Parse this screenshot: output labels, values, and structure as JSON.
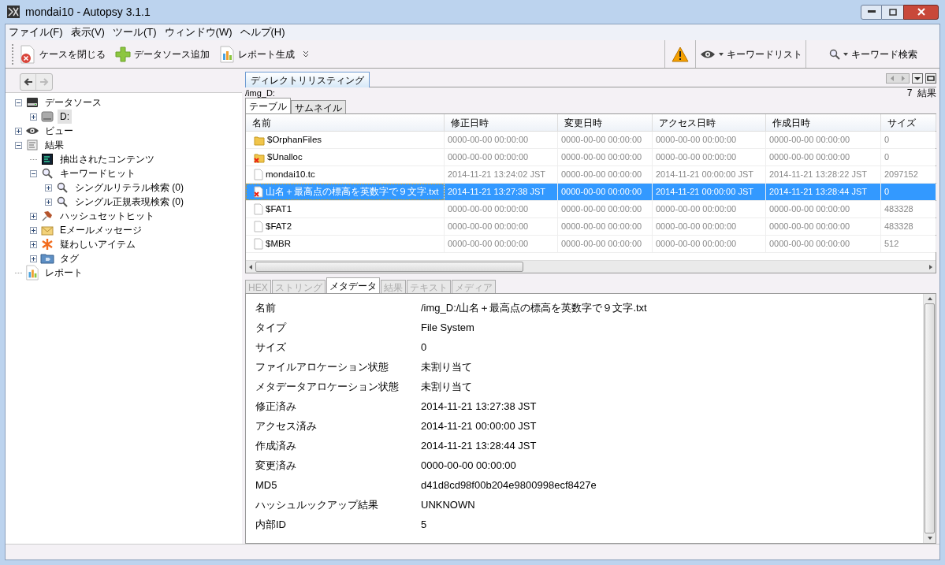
{
  "window": {
    "title": "mondai10 - Autopsy 3.1.1"
  },
  "menu": [
    "ファイル(F)",
    "表示(V)",
    "ツール(T)",
    "ウィンドウ(W)",
    "ヘルプ(H)"
  ],
  "toolbar": {
    "left": [
      {
        "kind": "close-case",
        "label": "ケースを閉じる"
      },
      {
        "kind": "add",
        "label": "データソース追加"
      },
      {
        "kind": "report",
        "label": "レポート生成"
      }
    ],
    "right": [
      {
        "kind": "warning"
      },
      {
        "kind": "eye",
        "label": "キーワードリスト"
      },
      {
        "kind": "search",
        "label": "キーワード検索"
      }
    ]
  },
  "tree": [
    {
      "label": "データソース",
      "kind": "drive",
      "expanded": true,
      "selected": false,
      "children": [
        {
          "label": "D:",
          "kind": "disk",
          "expanded": false,
          "selected": true
        }
      ]
    },
    {
      "label": "ビュー",
      "kind": "eye",
      "expanded": false,
      "selected": false
    },
    {
      "label": "結果",
      "kind": "results",
      "expanded": true,
      "selected": false,
      "children": [
        {
          "label": "抽出されたコンテンツ",
          "kind": "extracted",
          "selected": false
        },
        {
          "label": "キーワードヒット",
          "kind": "search",
          "expanded": true,
          "selected": false,
          "children": [
            {
              "label": "シングルリテラル検索 (0)",
              "kind": "search",
              "expanded": false,
              "selected": false
            },
            {
              "label": "シングル正規表現検索 (0)",
              "kind": "search",
              "expanded": false,
              "selected": false
            }
          ]
        },
        {
          "label": "ハッシュセットヒット",
          "kind": "pin",
          "expanded": false,
          "selected": false
        },
        {
          "label": "Eメールメッセージ",
          "kind": "mail",
          "expanded": false,
          "selected": false
        },
        {
          "label": "疑わしいアイテム",
          "kind": "asterisk",
          "expanded": false,
          "selected": false
        },
        {
          "label": "タグ",
          "kind": "tag",
          "expanded": false,
          "selected": false
        }
      ]
    },
    {
      "label": "レポート",
      "kind": "report",
      "selected": false
    }
  ],
  "directory_tab": "ディレクトリリスティング",
  "path": "/img_D:",
  "result_count": "7  結果",
  "view_tabs": [
    {
      "label": "テーブル",
      "selected": true
    },
    {
      "label": "サムネイル",
      "selected": false
    }
  ],
  "table": {
    "columns": [
      "名前",
      "修正日時",
      "変更日時",
      "アクセス日時",
      "作成日時",
      "サイズ"
    ],
    "rows": [
      {
        "kind": "folder",
        "selected": false,
        "cells": [
          "$OrphanFiles",
          "0000-00-00 00:00:00",
          "0000-00-00 00:00:00",
          "0000-00-00 00:00:00",
          "0000-00-00 00:00:00",
          "0"
        ]
      },
      {
        "kind": "folder-deleted",
        "selected": false,
        "cells": [
          "$Unalloc",
          "0000-00-00 00:00:00",
          "0000-00-00 00:00:00",
          "0000-00-00 00:00:00",
          "0000-00-00 00:00:00",
          "0"
        ]
      },
      {
        "kind": "file",
        "selected": false,
        "cells": [
          "mondai10.tc",
          "2014-11-21 13:24:02 JST",
          "0000-00-00 00:00:00",
          "2014-11-21 00:00:00 JST",
          "2014-11-21 13:28:22 JST",
          "2097152"
        ]
      },
      {
        "kind": "file-deleted",
        "selected": true,
        "cells": [
          "山名＋最高点の標高を英数字で９文字.txt",
          "2014-11-21 13:27:38 JST",
          "0000-00-00 00:00:00",
          "2014-11-21 00:00:00 JST",
          "2014-11-21 13:28:44 JST",
          "0"
        ]
      },
      {
        "kind": "file",
        "selected": false,
        "cells": [
          "$FAT1",
          "0000-00-00 00:00:00",
          "0000-00-00 00:00:00",
          "0000-00-00 00:00:00",
          "0000-00-00 00:00:00",
          "483328"
        ]
      },
      {
        "kind": "file",
        "selected": false,
        "cells": [
          "$FAT2",
          "0000-00-00 00:00:00",
          "0000-00-00 00:00:00",
          "0000-00-00 00:00:00",
          "0000-00-00 00:00:00",
          "483328"
        ]
      },
      {
        "kind": "file",
        "selected": false,
        "cells": [
          "$MBR",
          "0000-00-00 00:00:00",
          "0000-00-00 00:00:00",
          "0000-00-00 00:00:00",
          "0000-00-00 00:00:00",
          "512"
        ]
      }
    ]
  },
  "detail_tabs": [
    {
      "label": "HEX",
      "selected": false,
      "disabled": true
    },
    {
      "label": "ストリング",
      "selected": false,
      "disabled": true
    },
    {
      "label": "メタデータ",
      "selected": true,
      "disabled": false
    },
    {
      "label": "結果",
      "selected": false,
      "disabled": true
    },
    {
      "label": "テキスト",
      "selected": false,
      "disabled": true
    },
    {
      "label": "メディア",
      "selected": false,
      "disabled": true
    }
  ],
  "metadata": [
    {
      "label": "名前",
      "value": "/img_D:/山名＋最高点の標高を英数字で９文字.txt"
    },
    {
      "label": "タイプ",
      "value": "File System"
    },
    {
      "label": "サイズ",
      "value": "0"
    },
    {
      "label": "ファイルアロケーション状態",
      "value": "未割り当て"
    },
    {
      "label": "メタデータアロケーション状態",
      "value": "未割り当て"
    },
    {
      "label": "修正済み",
      "value": "2014-11-21 13:27:38 JST"
    },
    {
      "label": "アクセス済み",
      "value": "2014-11-21 00:00:00 JST"
    },
    {
      "label": "作成済み",
      "value": "2014-11-21 13:28:44 JST"
    },
    {
      "label": "変更済み",
      "value": "0000-00-00 00:00:00"
    },
    {
      "label": "MD5",
      "value": "d41d8cd98f00b204e9800998ecf8427e"
    },
    {
      "label": "ハッシュルックアップ結果",
      "value": "UNKNOWN"
    },
    {
      "label": "内部ID",
      "value": "5"
    }
  ]
}
